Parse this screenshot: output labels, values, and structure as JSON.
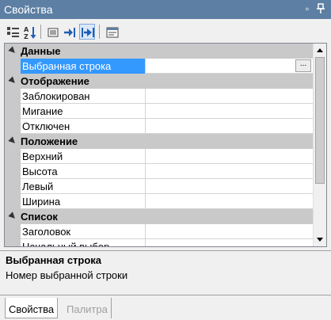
{
  "window": {
    "title": "Свойства"
  },
  "toolbar": {
    "buttons": [
      {
        "icon": "categorized-icon"
      },
      {
        "icon": "sort-alpha-icon"
      },
      {
        "icon": "list-icon"
      },
      {
        "icon": "arrow-right-bar-icon"
      },
      {
        "icon": "arrow-right-double-icon"
      },
      {
        "icon": "property-pages-icon"
      }
    ]
  },
  "grid": {
    "categories": {
      "data": "Данные",
      "display": "Отображение",
      "position": "Положение",
      "list": "Список"
    },
    "props": {
      "selected_row": {
        "name": "Выбранная строка",
        "value": ""
      },
      "locked": {
        "name": "Заблокирован",
        "value": ""
      },
      "blink": {
        "name": "Мигание",
        "value": ""
      },
      "disabled": {
        "name": "Отключен",
        "value": ""
      },
      "top": {
        "name": "Верхний",
        "value": ""
      },
      "height": {
        "name": "Высота",
        "value": ""
      },
      "left": {
        "name": "Левый",
        "value": ""
      },
      "width": {
        "name": "Ширина",
        "value": ""
      },
      "header": {
        "name": "Заголовок",
        "value": ""
      },
      "initial": {
        "name": "Начальный выбор",
        "value": ""
      }
    },
    "ellipsis": "..."
  },
  "description": {
    "title": "Выбранная строка",
    "text": "Номер выбранной строки"
  },
  "tabs": {
    "properties": "Свойства",
    "palette": "Палитра"
  },
  "colors": {
    "titlebar": "#5d7fa3",
    "selection": "#3399ff",
    "category": "#c9c9c9"
  }
}
